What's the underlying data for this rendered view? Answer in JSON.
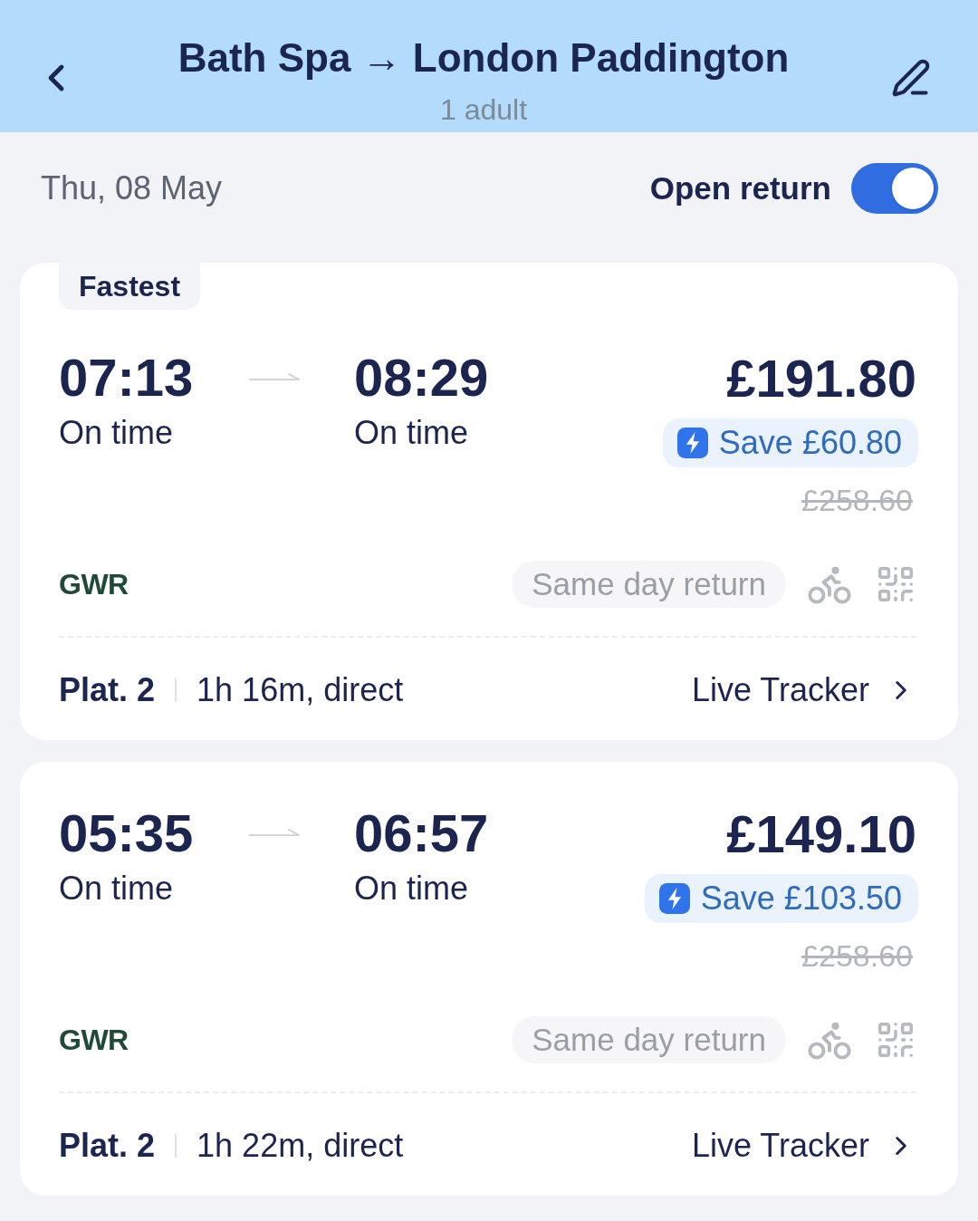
{
  "header": {
    "title": "Bath Spa → London Paddington",
    "subtitle": "1 adult"
  },
  "date": "Thu, 08 May",
  "open_return": {
    "label": "Open return",
    "on": true
  },
  "journeys": [
    {
      "tag": "Fastest",
      "depart": {
        "time": "07:13",
        "status": "On time"
      },
      "arrive": {
        "time": "08:29",
        "status": "On time"
      },
      "price": "£191.80",
      "saving": "Save £60.80",
      "original_price": "£258.60",
      "operator": "GWR",
      "ticket_type": "Same day return",
      "platform": "Plat. 2",
      "duration": "1h 16m, direct",
      "tracker": "Live Tracker"
    },
    {
      "depart": {
        "time": "05:35",
        "status": "On time"
      },
      "arrive": {
        "time": "06:57",
        "status": "On time"
      },
      "price": "£149.10",
      "saving": "Save £103.50",
      "original_price": "£258.60",
      "operator": "GWR",
      "ticket_type": "Same day return",
      "platform": "Plat. 2",
      "duration": "1h 22m, direct",
      "tracker": "Live Tracker"
    }
  ]
}
